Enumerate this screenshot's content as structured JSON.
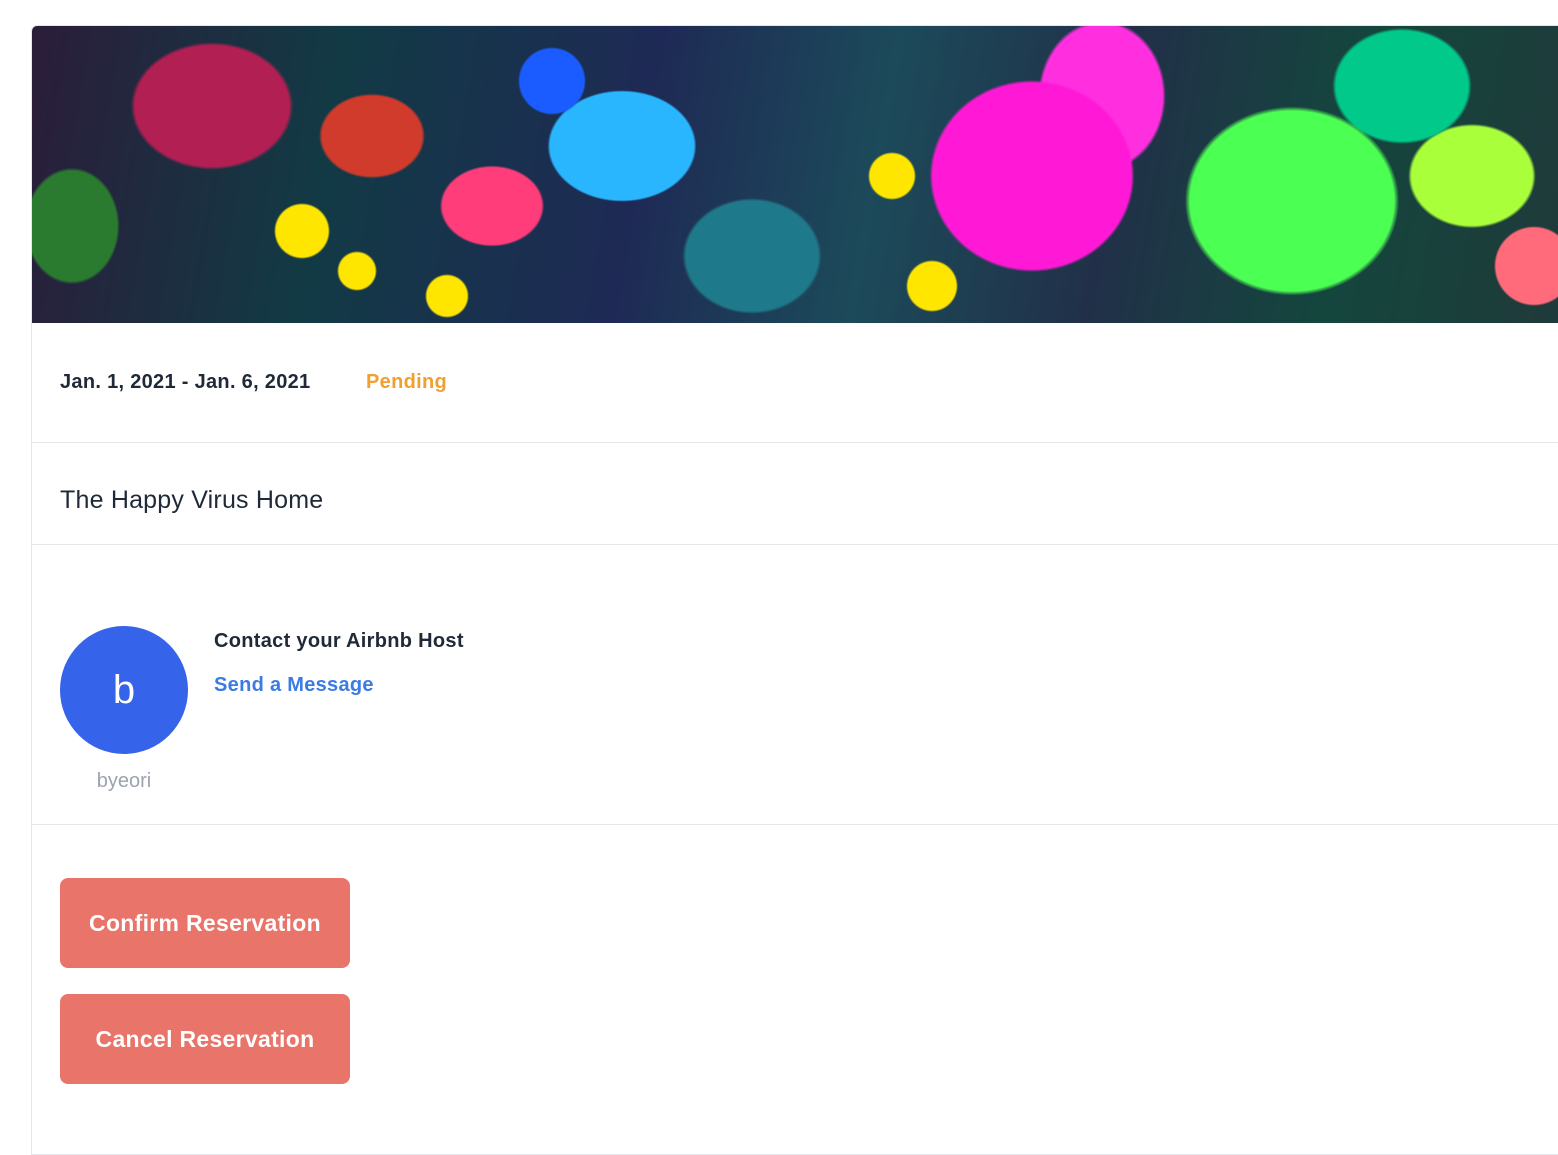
{
  "reservation": {
    "dates": "Jan. 1, 2021 - Jan. 6, 2021",
    "status": "Pending",
    "status_color": "#f0a030",
    "room_name": "The Happy Virus Home"
  },
  "host": {
    "avatar_initial": "b",
    "avatar_color": "#3563e9",
    "username": "byeori",
    "contact_title": "Contact your Airbnb Host",
    "send_message_label": "Send a Message"
  },
  "actions": {
    "confirm_label": "Confirm Reservation",
    "cancel_label": "Cancel Reservation",
    "button_color": "#e8746a"
  }
}
